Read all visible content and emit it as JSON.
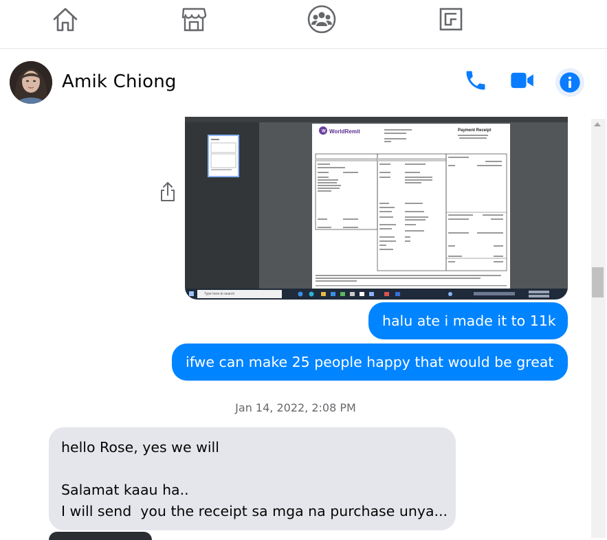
{
  "nav": {
    "items": [
      {
        "name": "home-icon"
      },
      {
        "name": "marketplace-icon"
      },
      {
        "name": "groups-icon"
      },
      {
        "name": "gaming-icon"
      }
    ]
  },
  "header": {
    "contact_name": "Amik Chiong",
    "buttons": [
      "phone-icon",
      "video-icon",
      "info-icon"
    ],
    "accent": "#0084ff"
  },
  "thread": {
    "receipt_image": {
      "brand": "WorldRemit",
      "title": "Payment Receipt",
      "search_placeholder": "Type here to search"
    },
    "outgoing": [
      "halu ate i made it to 11k",
      "ifwe can make 25 people happy that would be great"
    ],
    "timestamp": "Jan 14, 2022, 2:08 PM",
    "incoming": {
      "lines": [
        "hello Rose, yes we will",
        "",
        "Salamat kaau ha..",
        "I will send  you the receipt sa mga na purchase unya..."
      ]
    }
  },
  "colors": {
    "outgoing_bubble": "#0084ff",
    "incoming_bubble": "#e4e6eb",
    "icon_blue": "#0a7cff"
  }
}
